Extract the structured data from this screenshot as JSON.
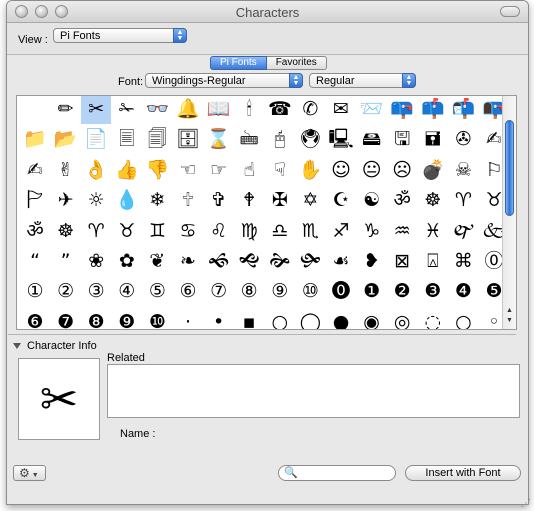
{
  "window": {
    "title": "Characters"
  },
  "view": {
    "label": "View :",
    "selected": "Pi Fonts"
  },
  "tabs": [
    {
      "label": "Pi Fonts",
      "selected": true
    },
    {
      "label": "Favorites",
      "selected": false
    }
  ],
  "font": {
    "label": "Font:",
    "family": "Wingdings-Regular",
    "style": "Regular"
  },
  "grid": {
    "selected_index": 2,
    "rows": [
      [
        "",
        "✏",
        "✂",
        "✁",
        "👓",
        "🔔",
        "📖",
        "🕯",
        "☎",
        "✆",
        "✉",
        "📨",
        "📪",
        "📫",
        "📬",
        "📭"
      ],
      [
        "📁",
        "📂",
        "📄",
        "🗏",
        "🗐",
        "🗄",
        "⌛",
        "🖮",
        "🖰",
        "🖲",
        "🖳",
        "🖴",
        "🖫",
        "🖬",
        "✇",
        "✍"
      ],
      [
        "✍",
        "✌",
        "👌",
        "👍",
        "👎",
        "☜",
        "☞",
        "☝",
        "☟",
        "✋",
        "☺",
        "😐",
        "☹",
        "💣",
        "☠",
        "⚐"
      ],
      [
        "🏱",
        "✈",
        "☼",
        "💧",
        "❄",
        "🕆",
        "✞",
        "🕈",
        "✠",
        "✡",
        "☪",
        "☯",
        "ॐ",
        "☸",
        "♈",
        "♉"
      ],
      [
        "ॐ",
        "☸",
        "♈",
        "♉",
        "♊",
        "♋",
        "♌",
        "♍",
        "♎",
        "♏",
        "♐",
        "♑",
        "♒",
        "♓",
        "🙰",
        "🙵"
      ],
      [
        "“",
        "”",
        "❀",
        "✿",
        "❦",
        "❧",
        "🙜",
        "🙝",
        "🙞",
        "🙟",
        "☙",
        "❥",
        "⊠",
        "⍓",
        "⌘",
        "⓪"
      ],
      [
        "①",
        "②",
        "③",
        "④",
        "⑤",
        "⑥",
        "⑦",
        "⑧",
        "⑨",
        "⑩",
        "⓿",
        "❶",
        "❷",
        "❸",
        "❹",
        "❺"
      ],
      [
        "❻",
        "❼",
        "❽",
        "❾",
        "❿",
        "·",
        "•",
        "▪",
        "○",
        "◯",
        "●",
        "◉",
        "◎",
        "◌",
        "○",
        "◦"
      ]
    ]
  },
  "character_info": {
    "label": "Character Info",
    "preview": "✂",
    "related_label": "Related",
    "name_label": "Name :"
  },
  "bottom": {
    "gear_icon": "gear-icon",
    "search_placeholder": "",
    "insert_button": "Insert with Font"
  }
}
